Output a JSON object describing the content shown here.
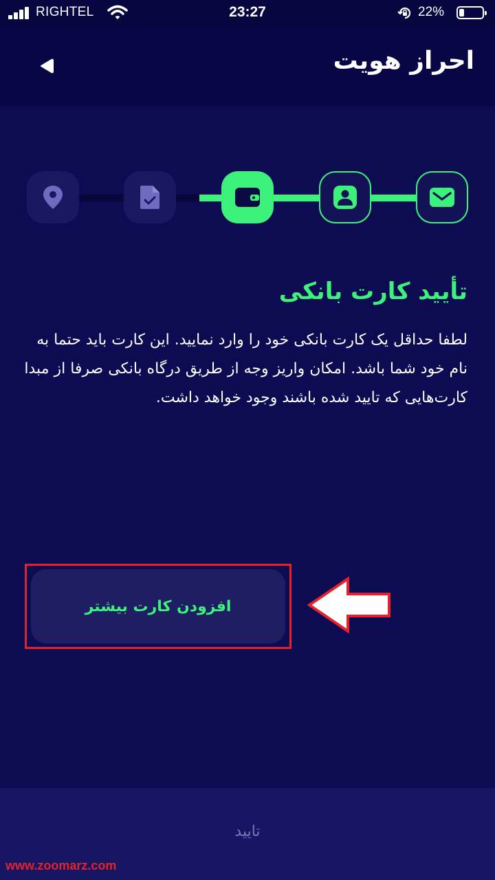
{
  "status_bar": {
    "carrier": "RIGHTEL",
    "time": "23:27",
    "battery": "22%",
    "battery_level": 0.22
  },
  "header": {
    "title": "احراز هویت",
    "back_icon": "back-arrow-icon"
  },
  "stepper": {
    "steps": [
      {
        "icon": "location-icon",
        "state": "pending"
      },
      {
        "icon": "document-check-icon",
        "state": "pending"
      },
      {
        "icon": "wallet-icon",
        "state": "active"
      },
      {
        "icon": "profile-icon",
        "state": "done"
      },
      {
        "icon": "email-icon",
        "state": "done"
      }
    ]
  },
  "content": {
    "title": "تأیید کارت بانکی",
    "description": "لطفا حداقل یک کارت بانکی خود را وارد نمایید. این کارت باید حتما به نام خود شما باشد. امکان واریز وجه از طریق درگاه بانکی صرفا از مبدا کارت‌هایی که تایید شده باشند وجود خواهد داشت."
  },
  "actions": {
    "add_card_label": "افزودن کارت بیشتر",
    "confirm_label": "تایید"
  },
  "watermark": "www.zoomarz.com",
  "colors": {
    "background": "#0d0b52",
    "header": "#080644",
    "accent": "#3cf27a",
    "highlight": "#e3232c",
    "footer": "#171664"
  }
}
